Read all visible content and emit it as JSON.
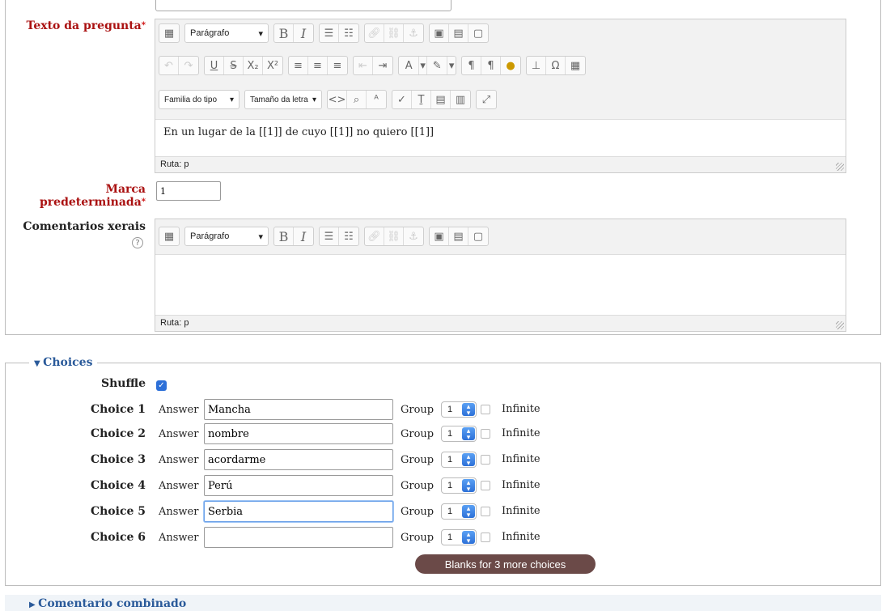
{
  "question_text": {
    "label": "Texto da pregunta",
    "required_mark": "*",
    "format_select": "Parágrafo",
    "font_family_select": "Familia do tipo",
    "font_size_select": "Tamaño da letra",
    "content": "En un lugar de la  [[1]] de cuyo  [[1]]  no quiero  [[1]]",
    "path": "Ruta: p"
  },
  "default_mark": {
    "label_line1": "Marca",
    "label_line2": "predeterminada",
    "required_mark": "*",
    "value": "1"
  },
  "general_feedback": {
    "label": "Comentarios xerais",
    "format_select": "Parágrafo",
    "path": "Ruta: p"
  },
  "choices_section": {
    "legend": "Choices",
    "shuffle_label": "Shuffle",
    "shuffle_checked": true,
    "answer_label": "Answer",
    "group_label": "Group",
    "infinite_label": "Infinite",
    "items": [
      {
        "label": "Choice 1",
        "answer": "Mancha",
        "group": "1"
      },
      {
        "label": "Choice 2",
        "answer": "nombre",
        "group": "1"
      },
      {
        "label": "Choice 3",
        "answer": "acordarme",
        "group": "1"
      },
      {
        "label": "Choice 4",
        "answer": "Perú",
        "group": "1"
      },
      {
        "label": "Choice 5",
        "answer": "Serbia",
        "group": "1"
      },
      {
        "label": "Choice 6",
        "answer": "",
        "group": "1"
      }
    ],
    "more_button": "Blanks for 3 more choices"
  },
  "next_section": {
    "legend": "Comentario combinado"
  },
  "colors": {
    "required_label": "#a11111",
    "legend": "#2a5a9a",
    "button": "#6b4a48",
    "checkbox": "#2d70d8"
  }
}
